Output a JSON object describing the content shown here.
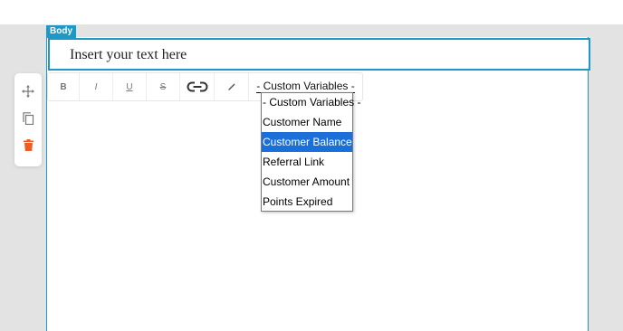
{
  "body_label": "Body",
  "text_block": {
    "content": "Insert your text here"
  },
  "side_tools": [
    {
      "icon": "move-icon"
    },
    {
      "icon": "copy-icon"
    },
    {
      "icon": "trash-icon",
      "color": "#f05a23"
    }
  ],
  "format_toolbar": {
    "bold": "B",
    "italic": "I",
    "underline": "U",
    "strikethrough": "S",
    "link_icon": "link-icon",
    "clear_icon": "pencil-icon",
    "custom_variables": "- Custom Variables -"
  },
  "dropdown": {
    "options": [
      {
        "label": "- Custom Variables -",
        "selected": false
      },
      {
        "label": "Customer Name",
        "selected": false
      },
      {
        "label": "Customer Balance",
        "selected": true
      },
      {
        "label": "Referral Link",
        "selected": false
      },
      {
        "label": "Customer Amount",
        "selected": false
      },
      {
        "label": "Points Expired",
        "selected": false
      }
    ]
  },
  "colors": {
    "accent": "#1e98c6",
    "selection": "#1a6fd8",
    "delete": "#f05a23",
    "canvas": "#e3e3e3"
  }
}
